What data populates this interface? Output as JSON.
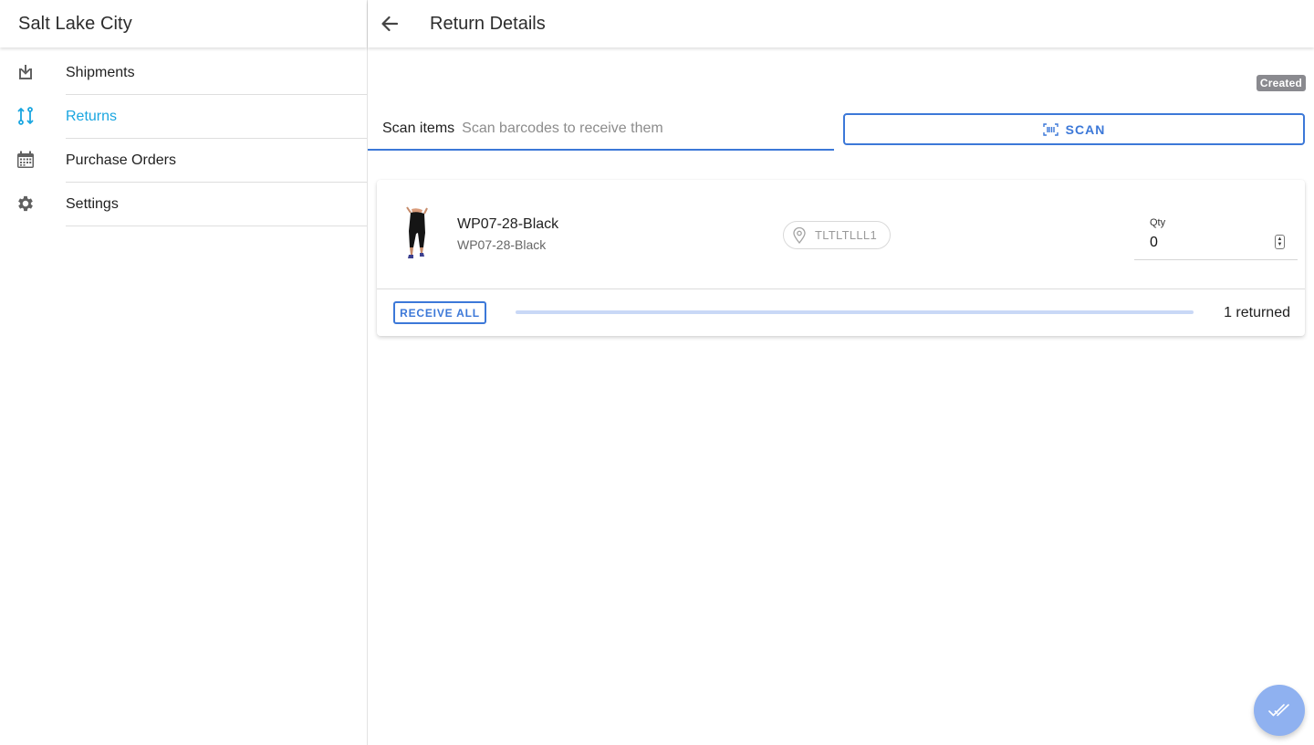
{
  "sidebar": {
    "title": "Salt Lake City",
    "items": [
      {
        "label": "Shipments",
        "icon": "download-box-icon",
        "active": false
      },
      {
        "label": "Returns",
        "icon": "return-arrows-icon",
        "active": true
      },
      {
        "label": "Purchase Orders",
        "icon": "calendar-icon",
        "active": false
      },
      {
        "label": "Settings",
        "icon": "gear-icon",
        "active": false
      }
    ]
  },
  "header": {
    "title": "Return Details",
    "back_icon": "arrow-left-icon"
  },
  "status": {
    "label": "Created"
  },
  "scan": {
    "label": "Scan items",
    "placeholder": "Scan barcodes to receive them",
    "button_label": "SCAN",
    "button_icon": "barcode-icon"
  },
  "items": [
    {
      "name": "WP07-28-Black",
      "sku": "WP07-28-Black",
      "location": "TLTLTLLL1",
      "location_icon": "location-pin-icon",
      "qty_label": "Qty",
      "qty_value": "0",
      "receive_all_label": "RECEIVE ALL",
      "progress_fraction": 0,
      "returned_text": "1 returned"
    }
  ],
  "fab": {
    "icon": "double-check-icon"
  },
  "colors": {
    "accent": "#3c78d8",
    "active_nav": "#1aa6e0",
    "badge": "#8a8a8f",
    "fab": "#8fb1f0"
  }
}
